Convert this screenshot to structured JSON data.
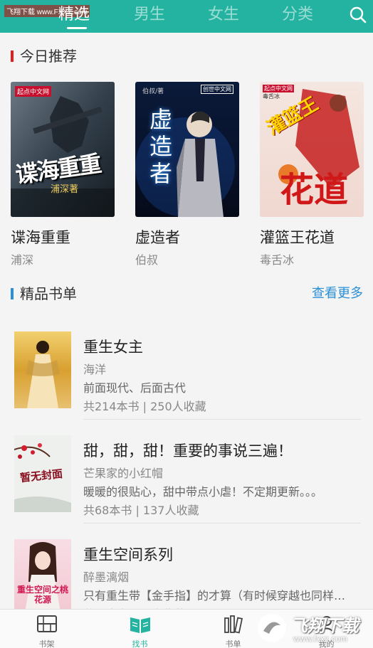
{
  "watermark_top": "飞翔下载 www.FXXZ.com",
  "tabs": [
    {
      "label": "精选",
      "active": true
    },
    {
      "label": "男生",
      "active": false
    },
    {
      "label": "女生",
      "active": false
    },
    {
      "label": "分类",
      "active": false
    }
  ],
  "today": {
    "title": "今日推荐",
    "books": [
      {
        "title": "谍海重重",
        "author": "浦深",
        "cover_text": "谍海重重",
        "cover_author": "浦深著",
        "publisher": "起点中文网"
      },
      {
        "title": "虚造者",
        "author": "伯叔",
        "cover_text": "虚造者",
        "cover_author": "伯叔/著",
        "publisher": "创世中文网"
      },
      {
        "title": "灌篮王花道",
        "author": "毒舌冰",
        "cover_text_top": "灌篮王",
        "cover_text_bottom": "花道",
        "cover_author": "毒舌冰",
        "publisher": "起点中文网"
      }
    ]
  },
  "booklists": {
    "title": "精品书单",
    "more": "查看更多",
    "items": [
      {
        "title": "重生女主",
        "author": "海洋",
        "desc": "前面现代、后面古代",
        "stats": "共214本书 | 250人收藏"
      },
      {
        "title": "甜，甜，甜！重要的事说三遍！",
        "author": "芒果家的小红帽",
        "desc": "暖暖的很贴心，甜中带点小虐！不定期更新。。。",
        "stats": "共68本书 | 137人收藏",
        "cover_text": "暂无封面"
      },
      {
        "title": "重生空间系列",
        "author": "醉墨漓烟",
        "desc": "只有重生带【金手指】的才算（有时候穿越也同样…",
        "stats": "共…本书 | …人收藏",
        "cover_text": "重生空间之桃花源"
      }
    ]
  },
  "bottom_nav": [
    {
      "label": "书架",
      "icon": "bookshelf-icon",
      "active": false
    },
    {
      "label": "找书",
      "icon": "open-book-icon",
      "active": true
    },
    {
      "label": "书单",
      "icon": "book-list-icon",
      "active": false
    },
    {
      "label": "我的",
      "icon": "profile-icon",
      "active": false
    }
  ],
  "watermark_bottom": {
    "brand": "飞翔下载",
    "url": "www.fxxz.com"
  },
  "colors": {
    "accent": "#23b3a0",
    "link": "#2a8fd6",
    "today_bar": "#e02020",
    "booklist_bar": "#2a8fd6"
  }
}
